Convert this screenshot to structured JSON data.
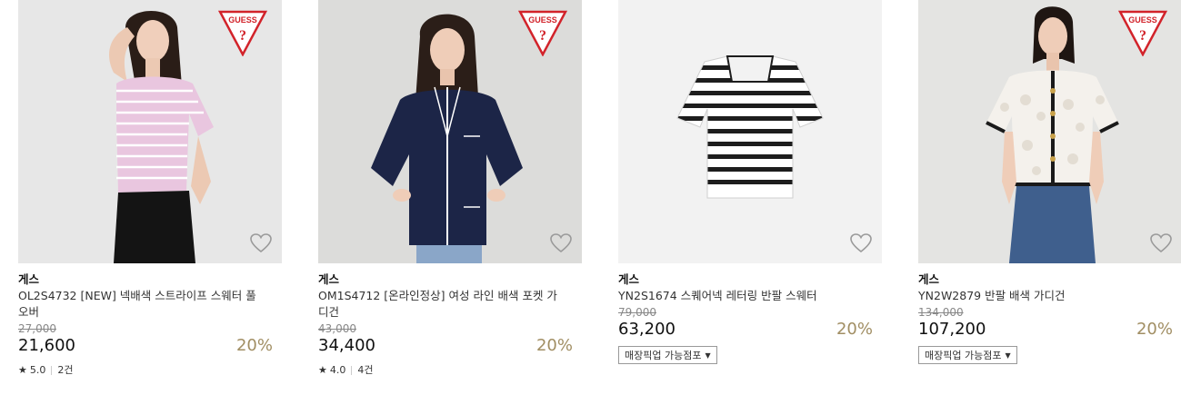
{
  "products": [
    {
      "brand": "게스",
      "name": "OL2S4732 [NEW] 넥배색 스트라이프 스웨터 풀오버",
      "original_price": "27,000",
      "price": "21,600",
      "discount": "20%",
      "rating": "5.0",
      "reviews": "2건",
      "has_logo": true,
      "image": "model in pink striped short-sleeve sweater"
    },
    {
      "brand": "게스",
      "name": "OM1S4712 [온라인정상] 여성 라인 배색 포켓 가디건",
      "original_price": "43,000",
      "price": "34,400",
      "discount": "20%",
      "rating": "4.0",
      "reviews": "4건",
      "has_logo": true,
      "image": "model in navy knit cardigan"
    },
    {
      "brand": "게스",
      "name": "YN2S1674 스퀘어넥 레터링 반팔 스웨터",
      "original_price": "79,000",
      "price": "63,200",
      "discount": "20%",
      "pickup": "매장픽업 가능점포",
      "has_logo": false,
      "image": "flat-lay black and white striped short-sleeve sweater"
    },
    {
      "brand": "게스",
      "name": "YN2W2879 반팔 배색 가디건",
      "original_price": "134,000",
      "price": "107,200",
      "discount": "20%",
      "pickup": "매장픽업 가능점포",
      "has_logo": true,
      "image": "model in white tweed short-sleeve cardigan"
    }
  ],
  "icons": {
    "wishlist": "heart-outline-icon",
    "logo": "guess-triangle-logo",
    "star": "star-icon",
    "dropdown": "caret-down-icon"
  },
  "colors": {
    "discount": "#a18e63",
    "logo_red": "#d2232a",
    "heart": "#9a9a9a"
  }
}
